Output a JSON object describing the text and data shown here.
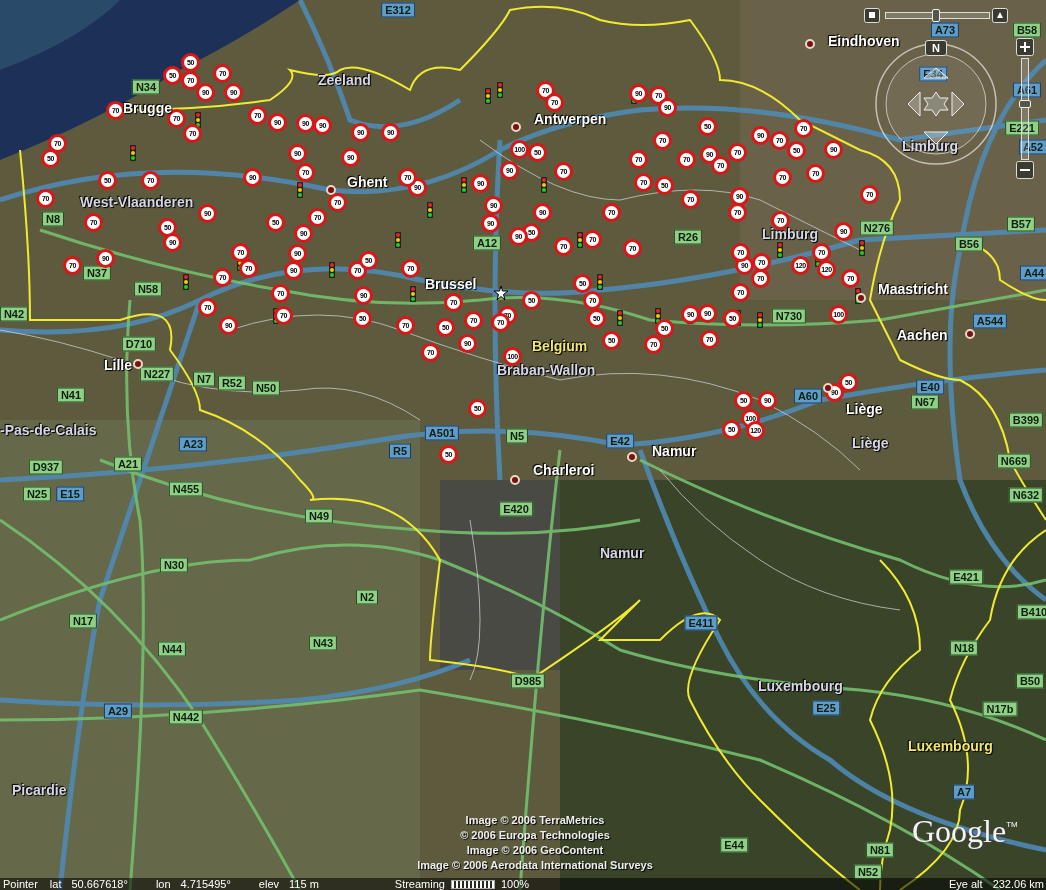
{
  "place_labels": [
    {
      "text": "Eindhoven",
      "kind": "city"
    },
    {
      "text": "Zeeland",
      "kind": "region"
    },
    {
      "text": "Brugge",
      "kind": "city"
    },
    {
      "text": "Antwerpen",
      "kind": "city"
    },
    {
      "text": "Limburg",
      "kind": "region"
    },
    {
      "text": "Ghent",
      "kind": "city"
    },
    {
      "text": "West-Vlaanderen",
      "kind": "region"
    },
    {
      "text": "Limburg",
      "kind": "region"
    },
    {
      "text": "Brussel",
      "kind": "city"
    },
    {
      "text": "Maastricht",
      "kind": "city"
    },
    {
      "text": "Belgium",
      "kind": "country"
    },
    {
      "text": "Aachen",
      "kind": "city"
    },
    {
      "text": "Braban-Wallon",
      "kind": "region"
    },
    {
      "text": "Lille",
      "kind": "city"
    },
    {
      "text": "Liège",
      "kind": "city"
    },
    {
      "text": "Liège",
      "kind": "region"
    },
    {
      "text": "-Pas-de-Calais",
      "kind": "region"
    },
    {
      "text": "Namur",
      "kind": "city"
    },
    {
      "text": "Charleroi",
      "kind": "city"
    },
    {
      "text": "Namur",
      "kind": "region"
    },
    {
      "text": "Luxembourg",
      "kind": "region"
    },
    {
      "text": "Luxembourg",
      "kind": "country"
    },
    {
      "text": "Picardie",
      "kind": "region"
    }
  ],
  "road_labels": [
    {
      "text": "E312",
      "kind": "motorway"
    },
    {
      "text": "A73",
      "kind": "motorway"
    },
    {
      "text": "B58",
      "kind": "road"
    },
    {
      "text": "N34",
      "kind": "road"
    },
    {
      "text": "E34",
      "kind": "motorway"
    },
    {
      "text": "A61",
      "kind": "motorway"
    },
    {
      "text": "E221",
      "kind": "road"
    },
    {
      "text": "A52",
      "kind": "motorway"
    },
    {
      "text": "A12",
      "kind": "road"
    },
    {
      "text": "R26",
      "kind": "road"
    },
    {
      "text": "N276",
      "kind": "road"
    },
    {
      "text": "B57",
      "kind": "road"
    },
    {
      "text": "B56",
      "kind": "road"
    },
    {
      "text": "A44",
      "kind": "motorway"
    },
    {
      "text": "N730",
      "kind": "road"
    },
    {
      "text": "A544",
      "kind": "motorway"
    },
    {
      "text": "N8",
      "kind": "road"
    },
    {
      "text": "N37",
      "kind": "road"
    },
    {
      "text": "N58",
      "kind": "road"
    },
    {
      "text": "N42",
      "kind": "road"
    },
    {
      "text": "D710",
      "kind": "road"
    },
    {
      "text": "N227",
      "kind": "road"
    },
    {
      "text": "N7",
      "kind": "road"
    },
    {
      "text": "R52",
      "kind": "road"
    },
    {
      "text": "N50",
      "kind": "road"
    },
    {
      "text": "N41",
      "kind": "road"
    },
    {
      "text": "A23",
      "kind": "motorway"
    },
    {
      "text": "D937",
      "kind": "road"
    },
    {
      "text": "A21",
      "kind": "road"
    },
    {
      "text": "N25",
      "kind": "road"
    },
    {
      "text": "E15",
      "kind": "motorway"
    },
    {
      "text": "N455",
      "kind": "road"
    },
    {
      "text": "N49",
      "kind": "road"
    },
    {
      "text": "N30",
      "kind": "road"
    },
    {
      "text": "N17",
      "kind": "road"
    },
    {
      "text": "N44",
      "kind": "road"
    },
    {
      "text": "N43",
      "kind": "road"
    },
    {
      "text": "N2",
      "kind": "road"
    },
    {
      "text": "A29",
      "kind": "motorway"
    },
    {
      "text": "N442",
      "kind": "road"
    },
    {
      "text": "D985",
      "kind": "road"
    },
    {
      "text": "E411",
      "kind": "motorway"
    },
    {
      "text": "E25",
      "kind": "motorway"
    },
    {
      "text": "N18",
      "kind": "road"
    },
    {
      "text": "N17b",
      "kind": "road"
    },
    {
      "text": "B50",
      "kind": "road"
    },
    {
      "text": "E421",
      "kind": "road"
    },
    {
      "text": "N632",
      "kind": "road"
    },
    {
      "text": "N669",
      "kind": "road"
    },
    {
      "text": "B399",
      "kind": "road"
    },
    {
      "text": "N67",
      "kind": "road"
    },
    {
      "text": "E40",
      "kind": "motorway"
    },
    {
      "text": "A60",
      "kind": "motorway"
    },
    {
      "text": "A501",
      "kind": "motorway"
    },
    {
      "text": "R5",
      "kind": "motorway"
    },
    {
      "text": "N5",
      "kind": "road"
    },
    {
      "text": "E42",
      "kind": "motorway"
    },
    {
      "text": "E420",
      "kind": "road"
    },
    {
      "text": "A7",
      "kind": "motorway"
    },
    {
      "text": "E44",
      "kind": "road"
    },
    {
      "text": "N81",
      "kind": "road"
    },
    {
      "text": "N52",
      "kind": "road"
    },
    {
      "text": "B410",
      "kind": "road"
    }
  ],
  "speed_limit_signs": [
    "70",
    "50",
    "90",
    "70",
    "70",
    "70",
    "50",
    "70",
    "70",
    "50",
    "70",
    "70",
    "90",
    "50",
    "90",
    "70",
    "90",
    "50",
    "70",
    "90",
    "70",
    "90",
    "90",
    "90",
    "90",
    "90",
    "90",
    "90",
    "90",
    "70",
    "70",
    "70",
    "50",
    "90",
    "90",
    "90",
    "70",
    "70",
    "70",
    "70",
    "90",
    "70",
    "70",
    "70",
    "50",
    "90",
    "50",
    "90",
    "70",
    "90",
    "90",
    "90",
    "70",
    "70",
    "70",
    "70",
    "50",
    "90",
    "70",
    "100",
    "70",
    "90",
    "70",
    "90",
    "70",
    "70",
    "100",
    "50",
    "90",
    "70",
    "70",
    "70",
    "70",
    "90",
    "70",
    "70",
    "50",
    "90",
    "70",
    "50",
    "70",
    "90",
    "70",
    "70",
    "70",
    "50",
    "70",
    "90",
    "70",
    "70",
    "70",
    "90",
    "70",
    "70",
    "70",
    "70",
    "50",
    "90",
    "50",
    "70",
    "50",
    "50",
    "70",
    "50",
    "90",
    "90",
    "50",
    "70",
    "70",
    "70",
    "90",
    "70",
    "70",
    "120",
    "120",
    "70",
    "70",
    "100",
    "90",
    "50",
    "50",
    "70",
    "90",
    "50",
    "50",
    "50",
    "90",
    "100",
    "50",
    "120"
  ],
  "navigation": {
    "north_label": "N",
    "zoom": {
      "level": 0.55
    },
    "tilt": {
      "level": 0.48
    }
  },
  "copyright": [
    "Image © 2006 TerraMetrics",
    "© 2006 Europa Technologies",
    "Image © 2006 GeoContent",
    "Image © 2006 Aerodata International Surveys"
  ],
  "logo": {
    "text": "Google",
    "mark": "TM"
  },
  "status_bar": {
    "pointer": "Pointer",
    "lat_label": "lat",
    "lat": "50.667618°",
    "lon_label": "lon",
    "lon": "4.715495°",
    "elev_label": "elev",
    "elev": "115 m",
    "streaming_label": "Streaming",
    "streaming": {
      "level": 1
    },
    "streaming_percent": "100%",
    "eye_alt_label": "Eye alt",
    "eye_alt": "232.06 km"
  }
}
